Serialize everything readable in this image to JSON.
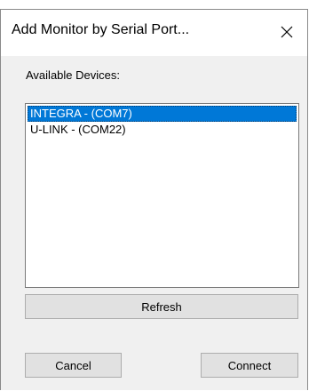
{
  "window": {
    "title": "Add Monitor by Serial Port...",
    "close_icon": "close-icon"
  },
  "devices": {
    "label": "Available Devices:",
    "items": [
      {
        "label": "INTEGRA - (COM7)",
        "selected": true
      },
      {
        "label": "U-LINK - (COM22)",
        "selected": false
      }
    ]
  },
  "buttons": {
    "refresh": "Refresh",
    "cancel": "Cancel",
    "connect": "Connect"
  },
  "colors": {
    "selection": "#0078d7",
    "button_face": "#e1e1e1",
    "dialog_bg": "#f0f0f0"
  }
}
